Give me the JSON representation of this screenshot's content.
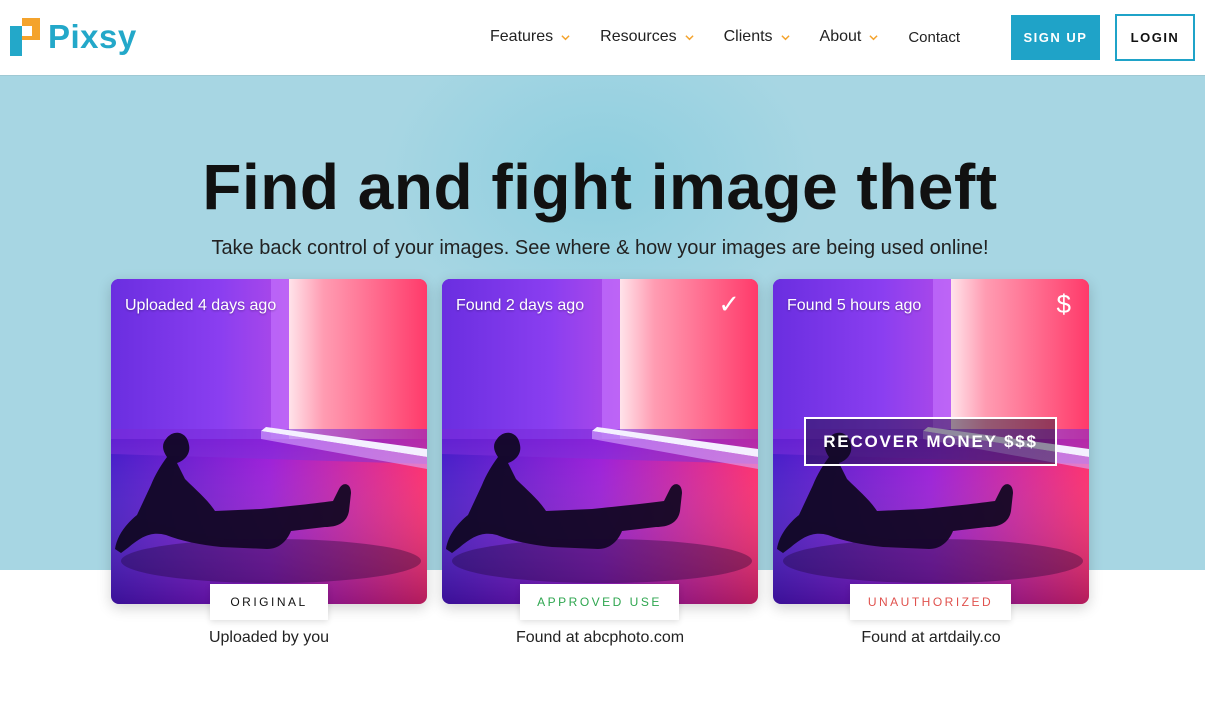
{
  "brand": {
    "name": "Pixsy",
    "accent": "#23a8c9",
    "accent_secondary": "#f4a32c"
  },
  "nav": {
    "items": [
      {
        "label": "Features",
        "icon": "chevron-down-icon"
      },
      {
        "label": "Resources",
        "icon": "chevron-down-icon"
      },
      {
        "label": "Clients",
        "icon": "chevron-down-icon"
      },
      {
        "label": "About",
        "icon": "chevron-down-icon"
      }
    ],
    "contact": "Contact",
    "signup": "SIGN UP",
    "login": "LOGIN"
  },
  "hero": {
    "title": "Find and fight image theft",
    "subtitle": "Take back control of your images. See where & how your images are being used online!",
    "background": "#a7d6e3"
  },
  "cards": [
    {
      "time": "Uploaded 4 days ago",
      "mark": "",
      "badge": "ORIGINAL",
      "badge_color": "#111111",
      "caption": "Uploaded by you"
    },
    {
      "time": "Found 2 days ago",
      "mark": "✓",
      "badge": "APPROVED USE",
      "badge_color": "#2ea64f",
      "caption": "Found at abcphoto.com"
    },
    {
      "time": "Found 5 hours ago",
      "mark": "$",
      "badge": "UNAUTHORIZED",
      "badge_color": "#e0524e",
      "caption": "Found at artdaily.co",
      "action": "RECOVER MONEY $$$"
    }
  ]
}
